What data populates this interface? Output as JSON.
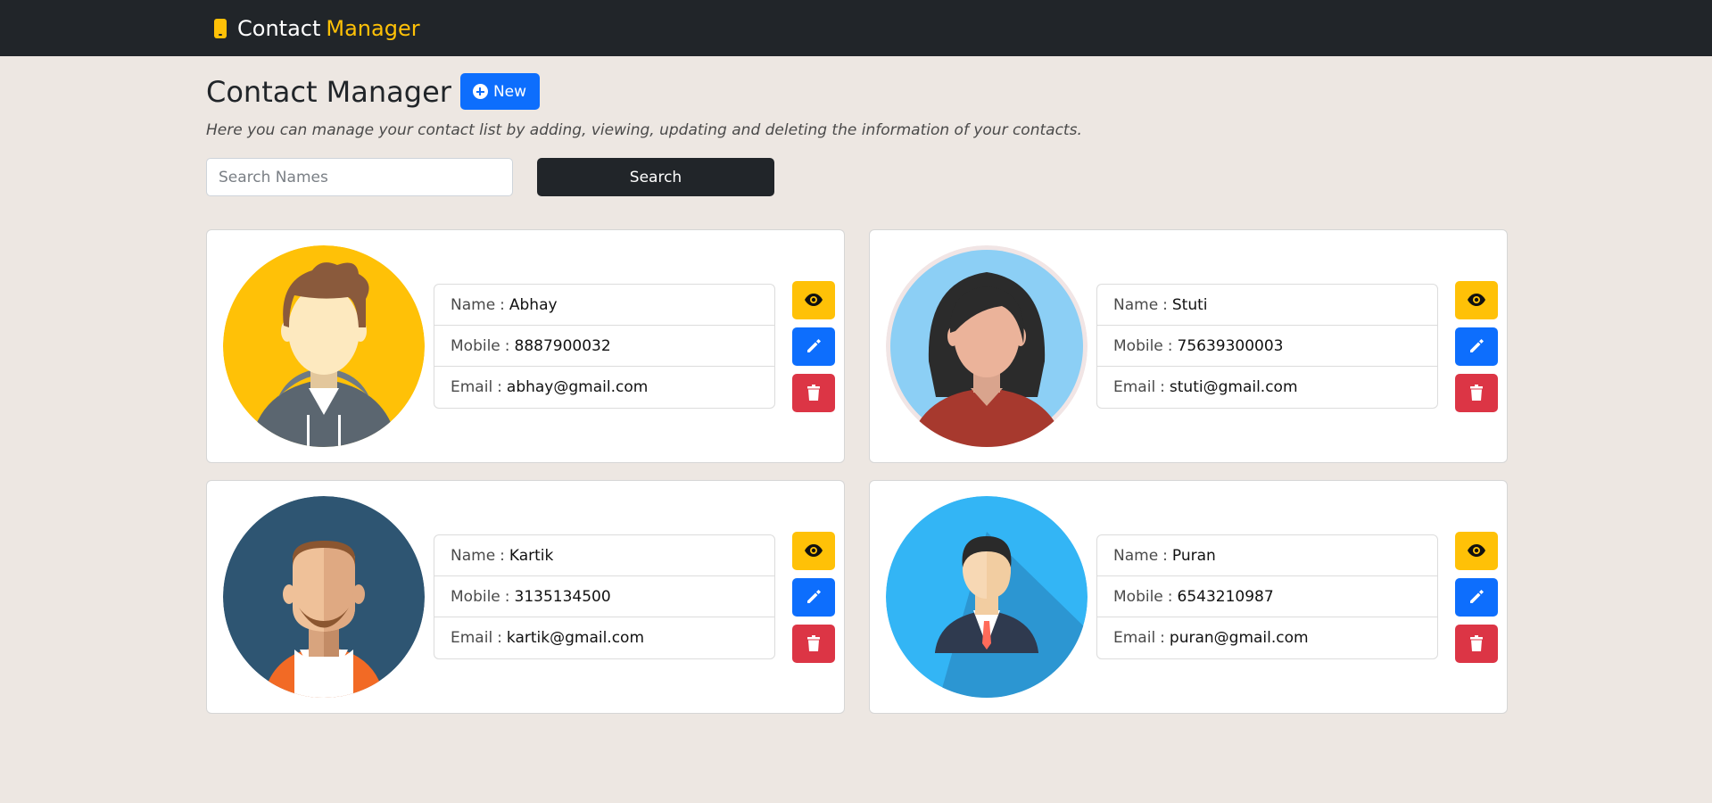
{
  "navbar": {
    "brand_main": "Contact",
    "brand_accent": "Manager",
    "brand_icon": "mobile-phone-icon"
  },
  "header": {
    "title": "Contact Manager",
    "new_button": "New",
    "subtitle": "Here you can manage your contact list by adding, viewing, updating and deleting the information of your contacts."
  },
  "search": {
    "placeholder": "Search Names",
    "value": "",
    "button": "Search"
  },
  "labels": {
    "name": "Name",
    "mobile": "Mobile",
    "email": "Email",
    "separator": ":"
  },
  "colors": {
    "view": "#ffc107",
    "edit": "#0d6efd",
    "delete": "#dc3545",
    "navbar": "#212529",
    "background": "#ede7e2"
  },
  "contacts": [
    {
      "name": "Abhay",
      "mobile": "8887900032",
      "email": "abhay@gmail.com",
      "avatar": "man-hoodie-avatar"
    },
    {
      "name": "Stuti",
      "mobile": "75639300003",
      "email": "stuti@gmail.com",
      "avatar": "woman-avatar"
    },
    {
      "name": "Kartik",
      "mobile": "3135134500",
      "email": "kartik@gmail.com",
      "avatar": "bearded-man-avatar"
    },
    {
      "name": "Puran",
      "mobile": "6543210987",
      "email": "puran@gmail.com",
      "avatar": "businessman-avatar"
    }
  ]
}
